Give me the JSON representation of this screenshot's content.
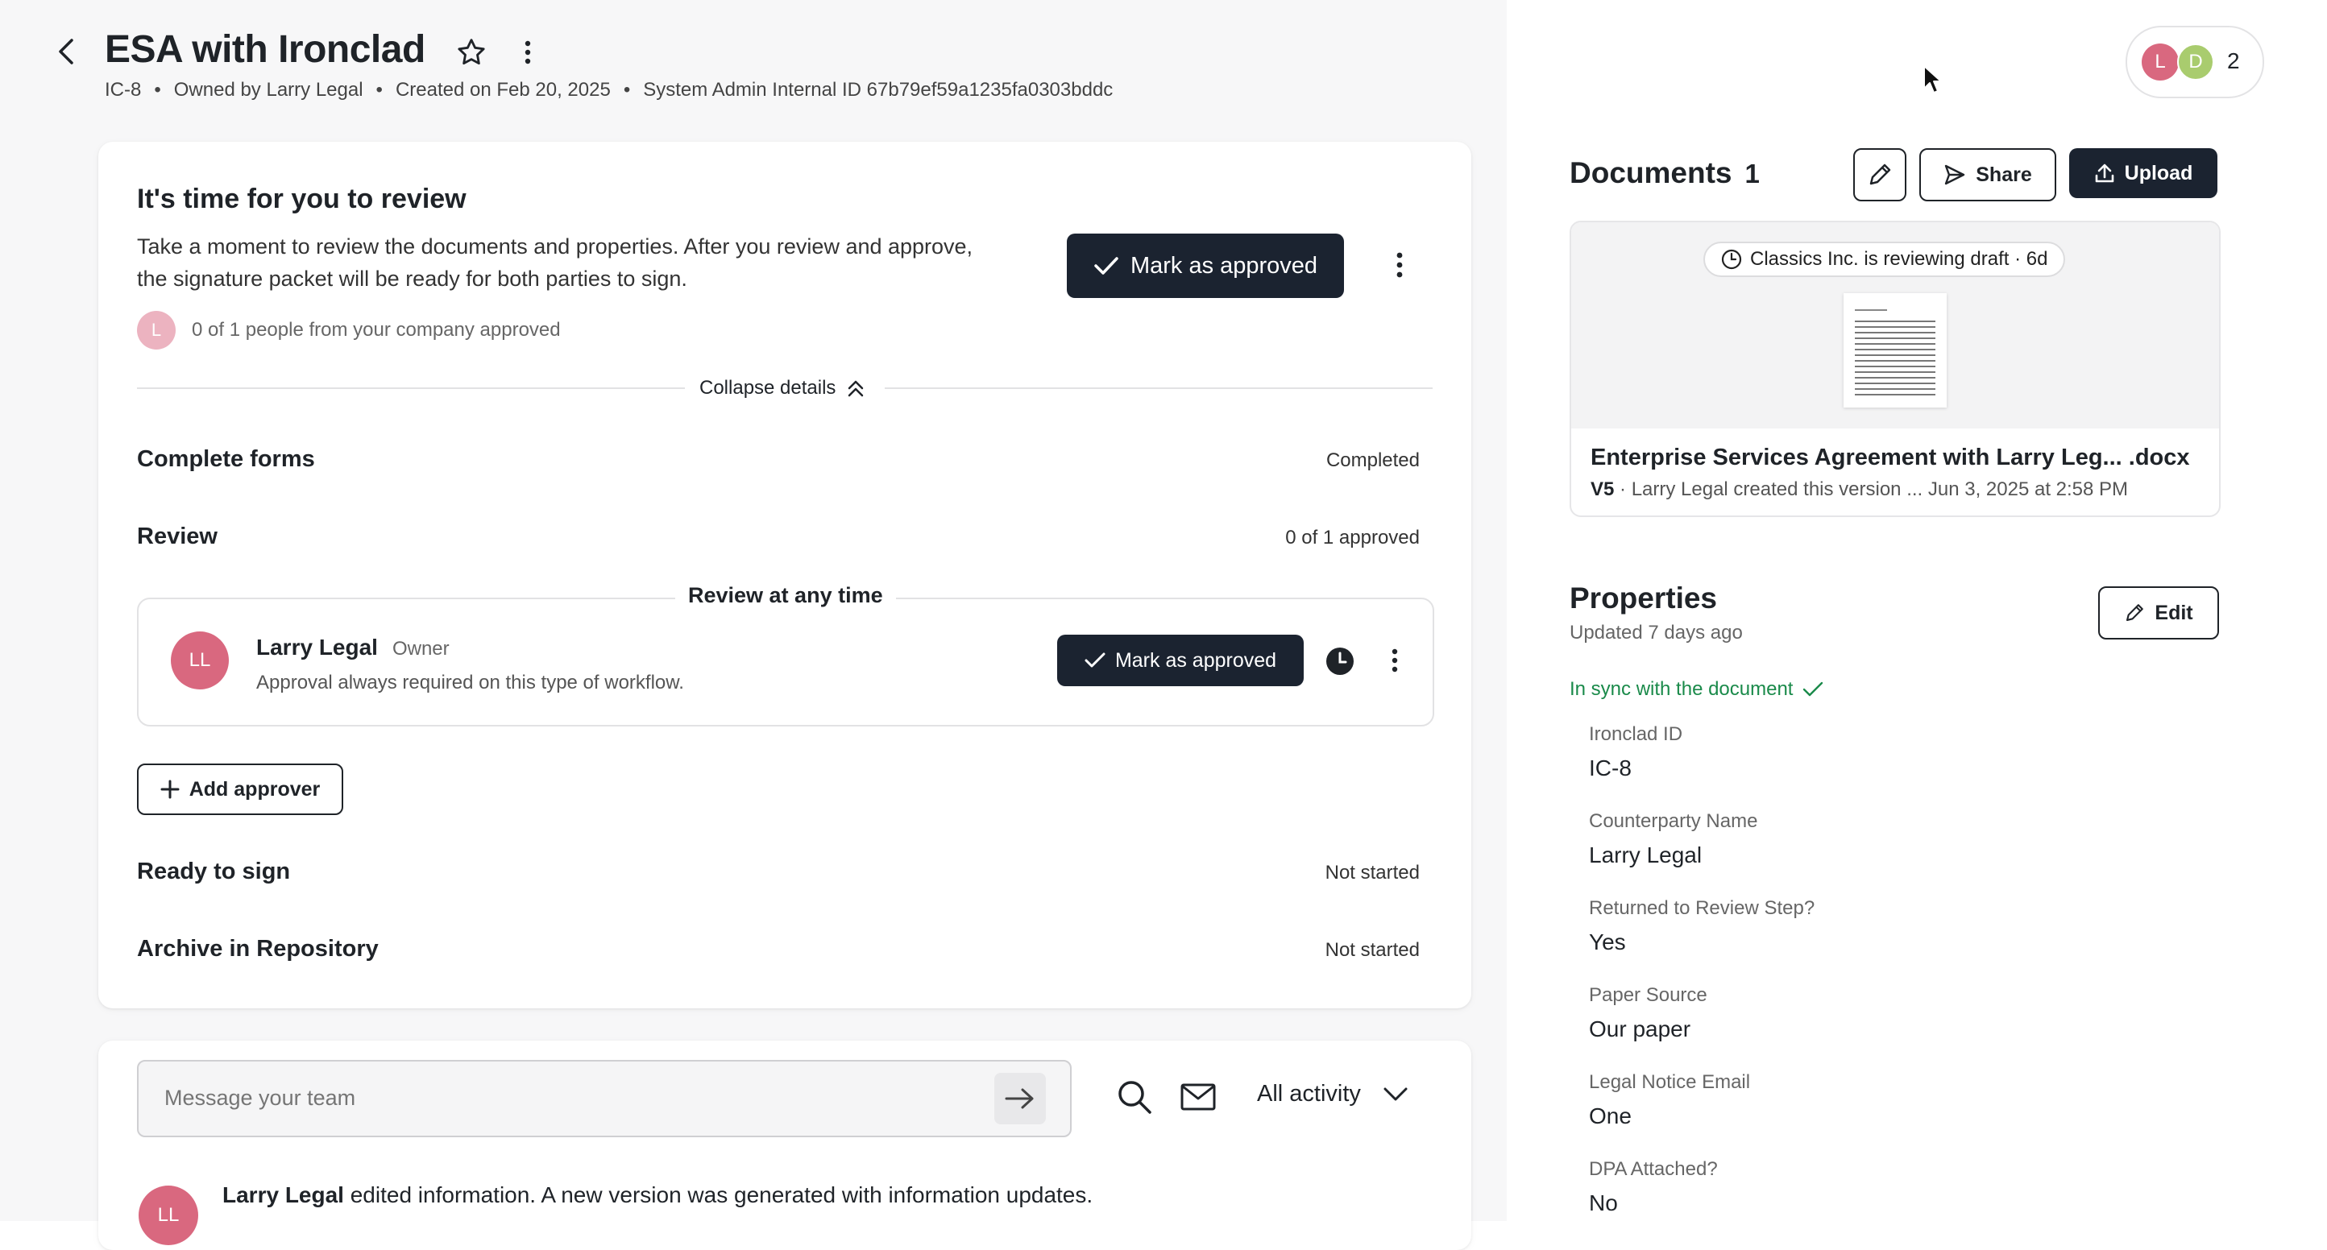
{
  "header": {
    "title": "ESA with Ironclad",
    "meta": {
      "id": "IC-8",
      "owner": "Owned by Larry Legal",
      "created": "Created on Feb 20, 2025",
      "internal_id": "System Admin Internal ID 67b79ef59a1235fa0303bddc"
    },
    "collaborators": {
      "avatars": [
        "L",
        "D"
      ],
      "count": "2"
    }
  },
  "review_card": {
    "title": "It's time for you to review",
    "description_line1": "Take a moment to review the documents and properties. After you review and approve,",
    "description_line2": "the signature packet will be ready for both parties to sign.",
    "approve_button": "Mark as approved",
    "approver_avatar": "L",
    "approval_progress": "0 of 1 people from your company approved",
    "collapse_label": "Collapse details",
    "steps": {
      "complete_forms": {
        "label": "Complete forms",
        "status": "Completed"
      },
      "review": {
        "label": "Review",
        "status": "0 of 1 approved"
      },
      "ready_to_sign": {
        "label": "Ready to sign",
        "status": "Not started"
      },
      "archive": {
        "label": "Archive in Repository",
        "status": "Not started"
      }
    },
    "review_group": {
      "title": "Review at any time",
      "approver": {
        "initials": "LL",
        "name": "Larry Legal",
        "role": "Owner",
        "note": "Approval always required on this type of workflow.",
        "approve_button": "Mark as approved"
      }
    },
    "add_approver": "Add approver"
  },
  "activity": {
    "message_placeholder": "Message your team",
    "filter": "All activity",
    "first_entry": {
      "author": "Larry Legal",
      "author_initials": "LL",
      "text": " edited information. A new version was generated with information updates."
    }
  },
  "documents": {
    "title": "Documents",
    "count": "1",
    "share": "Share",
    "upload": "Upload",
    "status_pill": "Classics Inc. is reviewing draft · 6d",
    "file_name": "Enterprise Services Agreement with Larry Leg... .docx",
    "version": "V5",
    "version_info": " · Larry Legal created this version ... Jun 3, 2025 at 2:58 PM"
  },
  "properties": {
    "title": "Properties",
    "updated": "Updated 7 days ago",
    "edit": "Edit",
    "sync_status": "In sync with the document",
    "fields": [
      {
        "label": "Ironclad ID",
        "value": "IC-8"
      },
      {
        "label": "Counterparty Name",
        "value": "Larry Legal"
      },
      {
        "label": "Returned to Review Step?",
        "value": "Yes"
      },
      {
        "label": "Paper Source",
        "value": "Our paper"
      },
      {
        "label": "Legal Notice Email",
        "value": "One"
      },
      {
        "label": "DPA Attached?",
        "value": "No"
      }
    ]
  },
  "colors": {
    "accent_dark": "#1b2330",
    "avatar_pink": "#d9687f",
    "avatar_green": "#a9cc6e",
    "sync_green": "#1a8a4a"
  }
}
